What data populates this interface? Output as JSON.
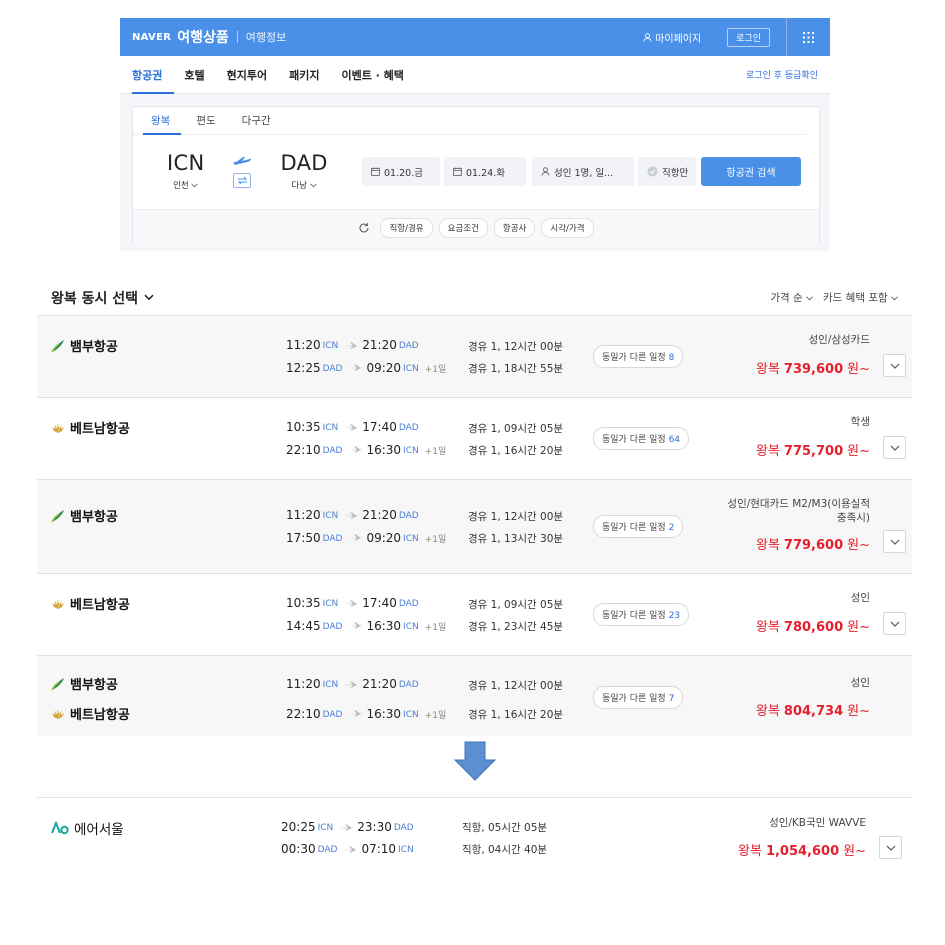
{
  "header": {
    "naver": "NAVER",
    "brand": "여행상품",
    "info": "여행정보",
    "mypage": "마이페이지",
    "login": "로그인"
  },
  "menu": {
    "items": [
      "항공권",
      "호텔",
      "현지투어",
      "패키지",
      "이벤트 · 혜택"
    ],
    "right": "로그인 후 등급확인"
  },
  "search": {
    "tabs": [
      "왕복",
      "편도",
      "다구간"
    ],
    "origin_code": "ICN",
    "origin_name": "인천",
    "dest_code": "DAD",
    "dest_name": "다낭",
    "depart_date": "01.20.금",
    "return_date": "01.24.화",
    "passengers": "성인 1명, 일...",
    "direct_only": "직항만",
    "search_button": "항공권 검색",
    "filters": [
      "직항/경유",
      "요금조건",
      "항공사",
      "시각/가격"
    ]
  },
  "results": {
    "title": "왕복 동시 선택",
    "sort_price": "가격 순",
    "sort_card": "카드 혜택 포함",
    "rows": [
      {
        "airlines": [
          "뱀부항공"
        ],
        "legs": [
          {
            "dep": "11:20",
            "dep_ap": "ICN",
            "arr": "21:20",
            "arr_ap": "DAD",
            "plus": ""
          },
          {
            "dep": "12:25",
            "dep_ap": "DAD",
            "arr": "09:20",
            "arr_ap": "ICN",
            "plus": "+1일"
          }
        ],
        "durations": [
          "경유 1, 12시간 00분",
          "경유 1, 18시간 55분"
        ],
        "other": "동일가 다른 일정",
        "other_count": "8",
        "fare": "성인/삼성카드",
        "price_label": "왕복",
        "price": "739,600",
        "unit": "원~"
      },
      {
        "airlines": [
          "베트남항공"
        ],
        "legs": [
          {
            "dep": "10:35",
            "dep_ap": "ICN",
            "arr": "17:40",
            "arr_ap": "DAD",
            "plus": ""
          },
          {
            "dep": "22:10",
            "dep_ap": "DAD",
            "arr": "16:30",
            "arr_ap": "ICN",
            "plus": "+1일"
          }
        ],
        "durations": [
          "경유 1, 09시간 05분",
          "경유 1, 16시간 20분"
        ],
        "other": "동일가 다른 일정",
        "other_count": "64",
        "fare": "학생",
        "price_label": "왕복",
        "price": "775,700",
        "unit": "원~"
      },
      {
        "airlines": [
          "뱀부항공"
        ],
        "legs": [
          {
            "dep": "11:20",
            "dep_ap": "ICN",
            "arr": "21:20",
            "arr_ap": "DAD",
            "plus": ""
          },
          {
            "dep": "17:50",
            "dep_ap": "DAD",
            "arr": "09:20",
            "arr_ap": "ICN",
            "plus": "+1일"
          }
        ],
        "durations": [
          "경유 1, 12시간 00분",
          "경유 1, 13시간 30분"
        ],
        "other": "동일가 다른 일정",
        "other_count": "2",
        "fare": "성인/현대카드 M2/M3(이용실적",
        "fare2": "충족시)",
        "price_label": "왕복",
        "price": "779,600",
        "unit": "원~"
      },
      {
        "airlines": [
          "베트남항공"
        ],
        "legs": [
          {
            "dep": "10:35",
            "dep_ap": "ICN",
            "arr": "17:40",
            "arr_ap": "DAD",
            "plus": ""
          },
          {
            "dep": "14:45",
            "dep_ap": "DAD",
            "arr": "16:30",
            "arr_ap": "ICN",
            "plus": "+1일"
          }
        ],
        "durations": [
          "경유 1, 09시간 05분",
          "경유 1, 23시간 45분"
        ],
        "other": "동일가 다른 일정",
        "other_count": "23",
        "fare": "성인",
        "price_label": "왕복",
        "price": "780,600",
        "unit": "원~"
      },
      {
        "airlines": [
          "뱀부항공",
          "베트남항공"
        ],
        "legs": [
          {
            "dep": "11:20",
            "dep_ap": "ICN",
            "arr": "21:20",
            "arr_ap": "DAD",
            "plus": ""
          },
          {
            "dep": "22:10",
            "dep_ap": "DAD",
            "arr": "16:30",
            "arr_ap": "ICN",
            "plus": "+1일"
          }
        ],
        "durations": [
          "경유 1, 12시간 00분",
          "경유 1, 16시간 20분"
        ],
        "other": "동일가 다른 일정",
        "other_count": "7",
        "fare": "성인",
        "price_label": "왕복",
        "price": "804,734",
        "unit": "원~"
      }
    ],
    "bottom": {
      "airline": "에어서울",
      "legs": [
        {
          "dep": "20:25",
          "dep_ap": "ICN",
          "arr": "23:30",
          "arr_ap": "DAD",
          "plus": ""
        },
        {
          "dep": "00:30",
          "dep_ap": "DAD",
          "arr": "07:10",
          "arr_ap": "ICN",
          "plus": ""
        }
      ],
      "durations": [
        "직항, 05시간 05분",
        "직항, 04시간 40분"
      ],
      "fare": "성인/KB국민 WAVVE",
      "price_label": "왕복",
      "price": "1,054,600",
      "unit": "원~"
    }
  },
  "colors": {
    "brand_blue": "#4a90e8",
    "link_blue": "#2c6fd9",
    "price_red": "#e5202e"
  }
}
